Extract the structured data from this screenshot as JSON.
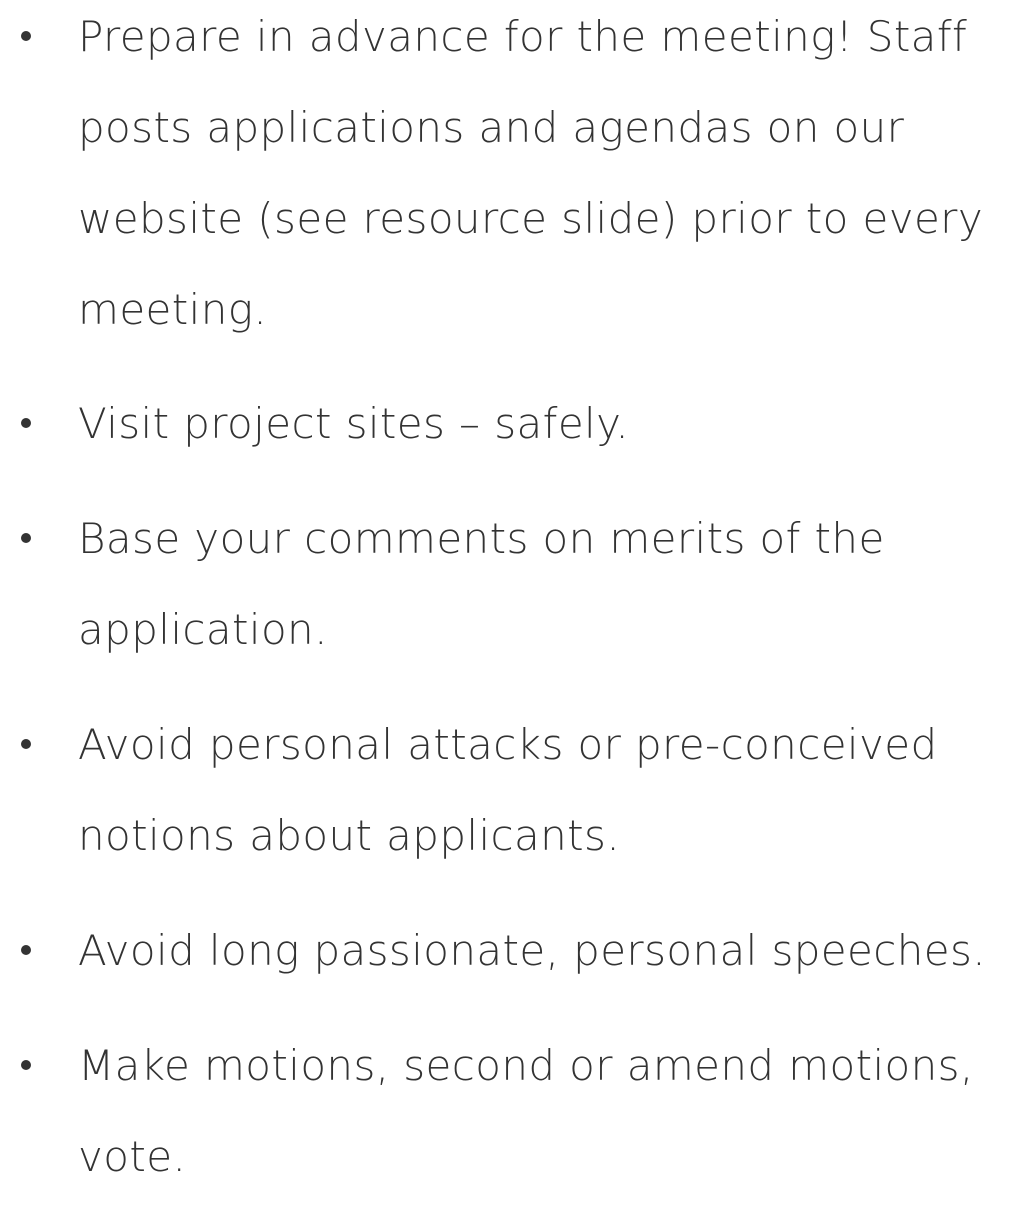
{
  "bullets": [
    {
      "lines": [
        "Prepare in advance for the meeting! Staff",
        "posts applications and agendas on our",
        "website (see resource slide) prior to every",
        "meeting."
      ]
    },
    {
      "lines": [
        "Visit project sites – safely."
      ]
    },
    {
      "lines": [
        "Base your comments on merits of the",
        "application."
      ]
    },
    {
      "lines": [
        "Avoid personal attacks or pre-conceived",
        "notions about applicants."
      ]
    },
    {
      "lines": [
        "Avoid long passionate, personal speeches."
      ]
    },
    {
      "lines": [
        "Make motions, second or amend motions,",
        "vote."
      ]
    }
  ]
}
